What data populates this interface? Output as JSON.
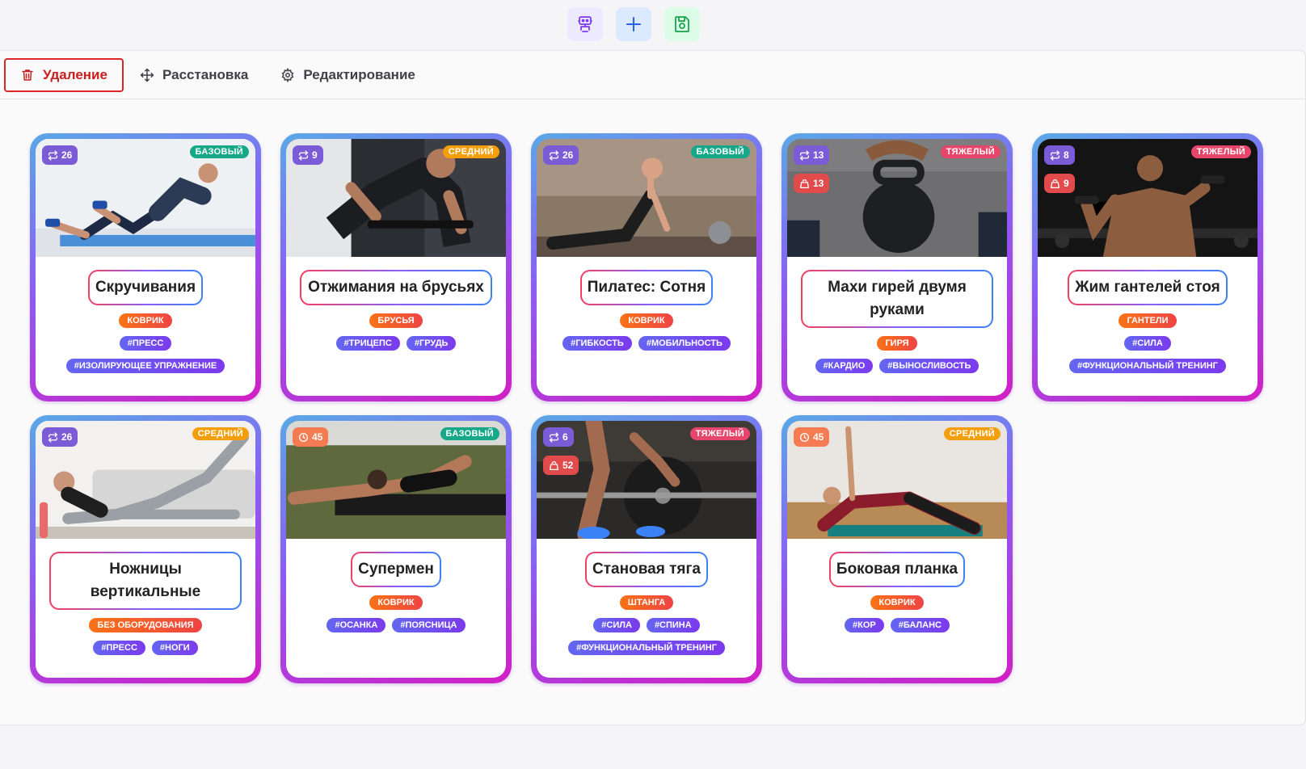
{
  "toolbar": {
    "buttons": [
      {
        "name": "robot",
        "icon": "robot-icon",
        "color": "#7c3aed"
      },
      {
        "name": "add",
        "icon": "plus-icon",
        "color": "#2563eb"
      },
      {
        "name": "save",
        "icon": "save-icon",
        "color": "#16a34a"
      }
    ]
  },
  "modes": {
    "delete": "Удаление",
    "arrange": "Расстановка",
    "edit": "Редактирование",
    "active": "delete"
  },
  "levels": {
    "basic": {
      "label": "БАЗОВЫЙ",
      "color": "#16a889"
    },
    "medium": {
      "label": "СРЕДНИЙ",
      "color": "#f59e0b"
    },
    "hard": {
      "label": "ТЯЖЕЛЫЙ",
      "color": "#e8456b"
    }
  },
  "cards": [
    {
      "title": "Скручивания",
      "level": "БАЗОВЫЙ",
      "level_color": "#16a889",
      "reps": "26",
      "equipment": "КОВРИК",
      "tags": [
        "#ПРЕСС",
        "#ИЗОЛИРУЮЩЕЕ УПРАЖНЕНИЕ"
      ]
    },
    {
      "title": "Отжимания на брусьях",
      "level": "СРЕДНИЙ",
      "level_color": "#f59e0b",
      "reps": "9",
      "equipment": "БРУСЬЯ",
      "tags": [
        "#ТРИЦЕПС",
        "#ГРУДЬ"
      ]
    },
    {
      "title": "Пилатес: Сотня",
      "level": "БАЗОВЫЙ",
      "level_color": "#16a889",
      "reps": "26",
      "equipment": "КОВРИК",
      "tags": [
        "#ГИБКОСТЬ",
        "#МОБИЛЬНОСТЬ"
      ]
    },
    {
      "title": "Махи гирей двумя руками",
      "level": "ТЯЖЕЛЫЙ",
      "level_color": "#e8456b",
      "reps": "13",
      "weight": "13",
      "equipment": "ГИРЯ",
      "tags": [
        "#КАРДИО",
        "#ВЫНОСЛИВОСТЬ"
      ]
    },
    {
      "title": "Жим гантелей стоя",
      "level": "ТЯЖЕЛЫЙ",
      "level_color": "#e8456b",
      "reps": "8",
      "weight": "9",
      "equipment": "ГАНТЕЛИ",
      "tags": [
        "#СИЛА",
        "#ФУНКЦИОНАЛЬНЫЙ ТРЕНИНГ"
      ]
    },
    {
      "title": "Ножницы вертикальные",
      "level": "СРЕДНИЙ",
      "level_color": "#f59e0b",
      "reps": "26",
      "equipment": "БЕЗ ОБОРУДОВАНИЯ",
      "tags": [
        "#ПРЕСС",
        "#НОГИ"
      ]
    },
    {
      "title": "Супермен",
      "level": "БАЗОВЫЙ",
      "level_color": "#16a889",
      "time": "45",
      "equipment": "КОВРИК",
      "tags": [
        "#ОСАНКА",
        "#ПОЯСНИЦА"
      ]
    },
    {
      "title": "Становая тяга",
      "level": "ТЯЖЕЛЫЙ",
      "level_color": "#e8456b",
      "reps": "6",
      "weight": "52",
      "equipment": "ШТАНГА",
      "tags": [
        "#СИЛА",
        "#СПИНА",
        "#ФУНКЦИОНАЛЬНЫЙ ТРЕНИНГ"
      ]
    },
    {
      "title": "Боковая планка",
      "level": "СРЕДНИЙ",
      "level_color": "#f59e0b",
      "time": "45",
      "equipment": "КОВРИК",
      "tags": [
        "#КОР",
        "#БАЛАНС"
      ]
    }
  ]
}
